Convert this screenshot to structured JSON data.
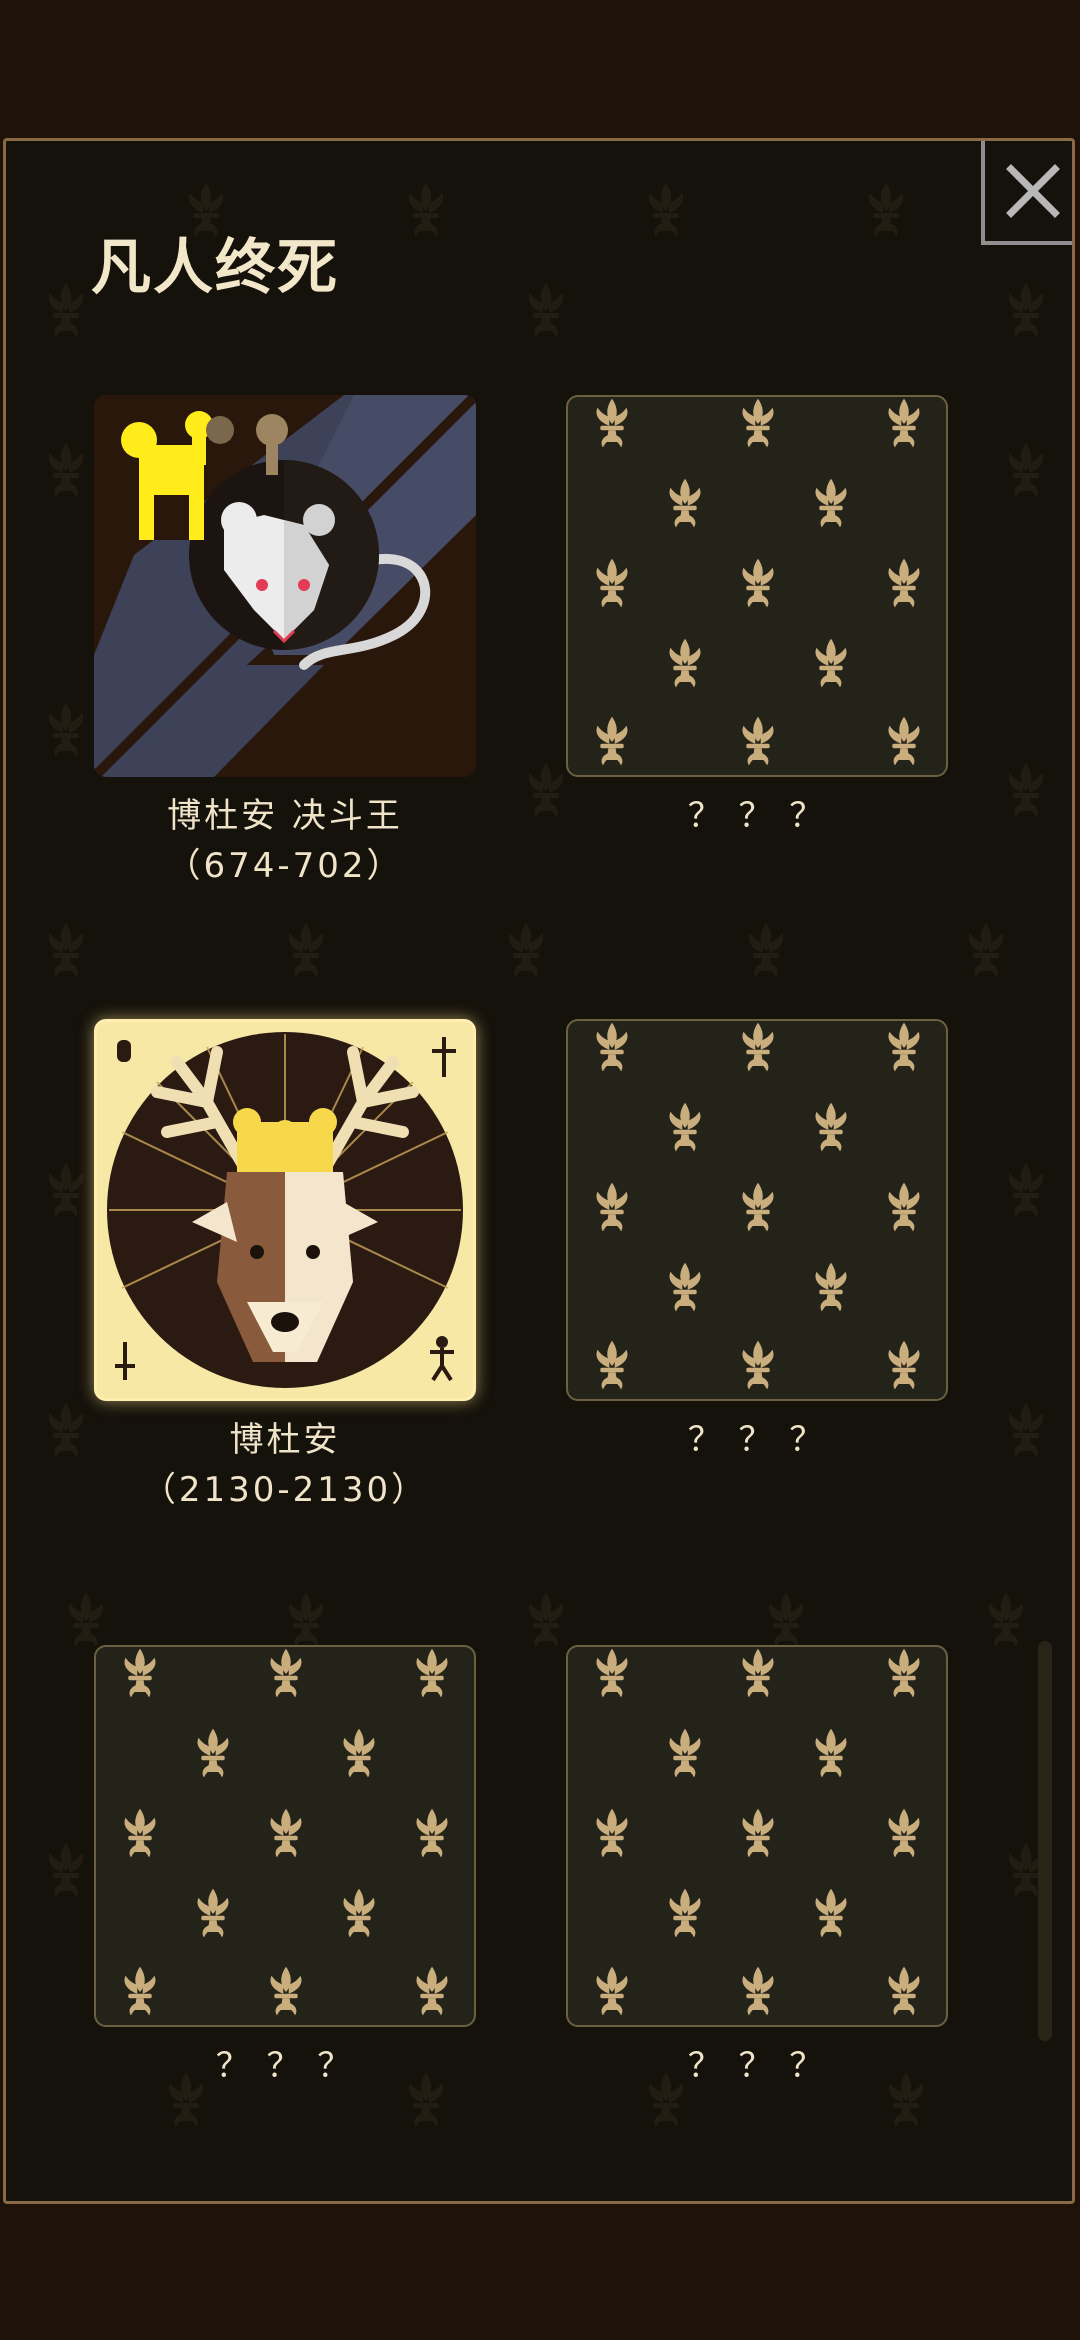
{
  "panel": {
    "title": "凡人终死",
    "close_icon": "close-icon"
  },
  "cards": [
    {
      "name": "博杜安  决斗王",
      "dates": "（674-702）",
      "state": "unlocked",
      "icon": "crowned-rat-portrait"
    },
    {
      "name": "？ ？ ？",
      "dates": "",
      "state": "locked",
      "icon": "fleur-de-lis-pattern"
    },
    {
      "name": "博杜安",
      "dates": "（2130-2130）",
      "state": "unlocked",
      "icon": "crowned-deer-portrait"
    },
    {
      "name": "？ ？ ？",
      "dates": "",
      "state": "locked",
      "icon": "fleur-de-lis-pattern"
    },
    {
      "name": "？ ？ ？",
      "dates": "",
      "state": "locked",
      "icon": "fleur-de-lis-pattern"
    },
    {
      "name": "？ ？ ？",
      "dates": "",
      "state": "locked",
      "icon": "fleur-de-lis-pattern"
    }
  ],
  "colors": {
    "panel_border": "#8a6a44",
    "gold": "#c9ad7c",
    "text": "#f0e4c8"
  }
}
